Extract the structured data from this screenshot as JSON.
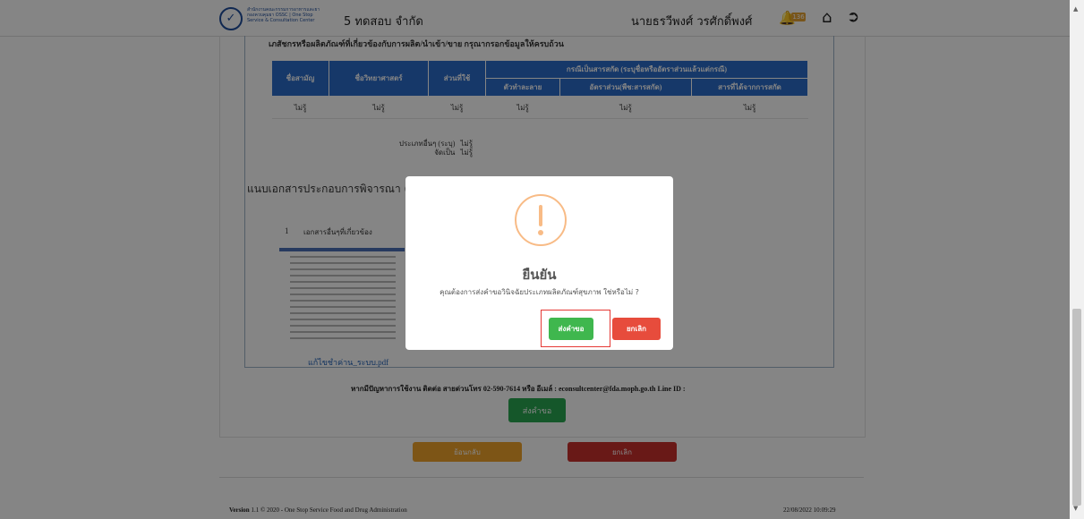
{
  "header": {
    "logo_symbol": "✓",
    "org_name": "สำนักงานคณะกรรมการอาหารและยา กองควบคุมยา OSSC | One Stop Service & Consultation Center",
    "company": "5 ทดสอบ จำกัด",
    "username": "นายธรวีพงศ์ วรศักดิ์พงศ์",
    "notification_count": "136",
    "icons": [
      "bell-icon",
      "home-icon",
      "sign-out-icon"
    ]
  },
  "content": {
    "heading_top": "เภสัชกรหรือผลิตภัณฑ์ที่เกี่ยวข้องกับการผลิต/นำเข้า/ขาย กรุณากรอกข้อมูลให้ครบถ้วน",
    "table": {
      "col_headers": [
        "ชื่อสามัญ",
        "ชื่อวิทยาศาสตร์",
        "ส่วนที่ใช้"
      ],
      "group_header": "กรณีเป็นสารสกัด (ระบุชื่อหรืออัตราส่วนแล้วแต่กรณี)",
      "sub_headers": [
        "ตัวทำละลาย",
        "อัตราส่วน(พืช:สารสกัด)",
        "สารที่ได้จากการสกัด"
      ],
      "rows": [
        [
          "ไม่รู้",
          "ไม่รู้",
          "ไม่รู้",
          "ไม่รู้",
          "ไม่รู้",
          "ไม่รู้"
        ]
      ]
    },
    "other_type_label": "ประเภทอื่นๆ (ระบุ)",
    "other_type_value": "ไม่รู้",
    "as_label": "จัดเป็น",
    "as_value": "ไม่รู้",
    "attachments_title": "แนบเอกสารประกอบการพิจารณา (",
    "attachment_number": "1",
    "attachment_name": "เอกสารอื่นๆที่เกี่ยวข้อง",
    "pdf_link": "แก้ไขชำค่าน_ระบบ.pdf",
    "contact": "หากมีปัญหาการใช้งาน ติดต่อ สายด่วนโทร 02-590-7614 หรือ อีเมล์ : econsultcenter@fda.moph.go.th Line ID :",
    "request_button": "ส่งคำขอ",
    "back_button": "ย้อนกลับ",
    "cancel_button": "ยกเลิก"
  },
  "footer": {
    "version_label": "Version",
    "version_text": " 1.1 © 2020 - One Stop Service Food and Drug Administration",
    "datetime": "22/08/2022 10:09:29"
  },
  "modal": {
    "icon": "exclamation-icon",
    "title": "ยืนยัน",
    "message": "คุณต้องการส่งคำขอวินิจฉัยประเภทผลิตภัณฑ์สุขภาพ ใช่หรือไม่ ?",
    "confirm_label": "ส่งคำขอ",
    "cancel_label": "ยกเลิก",
    "colors": {
      "confirm": "#3fb74e",
      "cancel": "#e74c3c",
      "warning": "#f8bb86",
      "highlight": "#e53935"
    }
  },
  "colors": {
    "table_header": "#2b6bc9",
    "request_button": "#2aa852",
    "back_button": "#f0a32b",
    "cancel_button": "#c9302c"
  }
}
